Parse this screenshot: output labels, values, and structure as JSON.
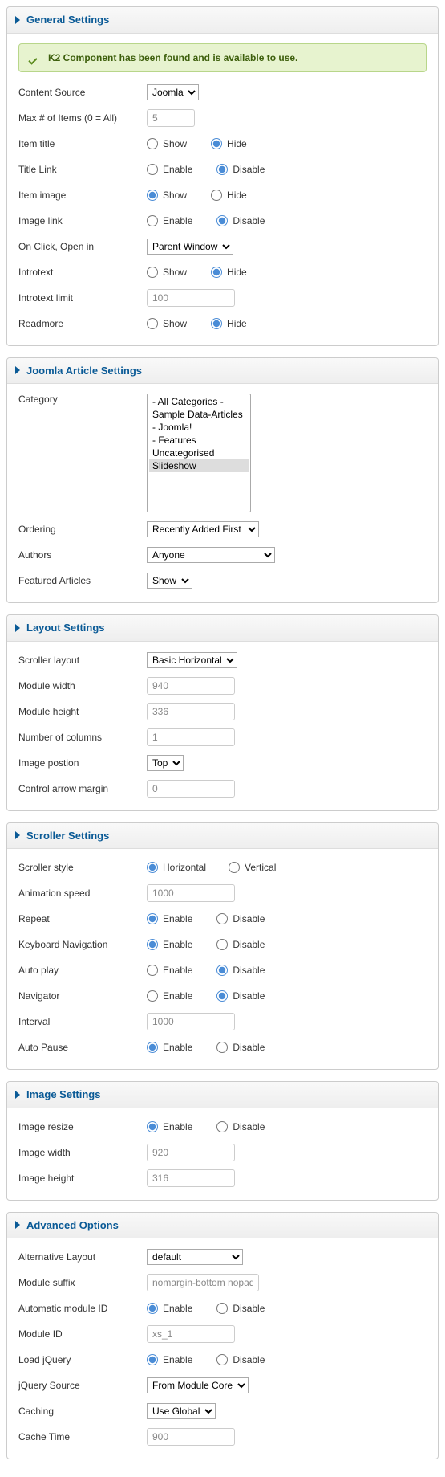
{
  "general": {
    "title": "General Settings",
    "info": "K2 Component has been found and is available to use.",
    "content_source": {
      "label": "Content Source",
      "value": "Joomla"
    },
    "max_items": {
      "label": "Max # of Items (0 = All)",
      "value": "5"
    },
    "item_title": {
      "label": "Item title",
      "opt1": "Show",
      "opt2": "Hide"
    },
    "title_link": {
      "label": "Title Link",
      "opt1": "Enable",
      "opt2": "Disable"
    },
    "item_image": {
      "label": "Item image",
      "opt1": "Show",
      "opt2": "Hide"
    },
    "image_link": {
      "label": "Image link",
      "opt1": "Enable",
      "opt2": "Disable"
    },
    "on_click": {
      "label": "On Click, Open in",
      "value": "Parent Window"
    },
    "introtext": {
      "label": "Introtext",
      "opt1": "Show",
      "opt2": "Hide"
    },
    "introtext_limit": {
      "label": "Introtext limit",
      "value": "100"
    },
    "readmore": {
      "label": "Readmore",
      "opt1": "Show",
      "opt2": "Hide"
    }
  },
  "joomla": {
    "title": "Joomla Article Settings",
    "category": {
      "label": "Category",
      "options": [
        "- All Categories -",
        "Sample Data-Articles",
        "- Joomla!",
        "- Features",
        "Uncategorised",
        "Slideshow"
      ]
    },
    "ordering": {
      "label": "Ordering",
      "value": "Recently Added First"
    },
    "authors": {
      "label": "Authors",
      "value": "Anyone"
    },
    "featured": {
      "label": "Featured Articles",
      "value": "Show"
    }
  },
  "layout": {
    "title": "Layout Settings",
    "scroller_layout": {
      "label": "Scroller layout",
      "value": "Basic Horizontal"
    },
    "module_width": {
      "label": "Module width",
      "value": "940"
    },
    "module_height": {
      "label": "Module height",
      "value": "336"
    },
    "num_columns": {
      "label": "Number of columns",
      "value": "1"
    },
    "image_position": {
      "label": "Image postion",
      "value": "Top"
    },
    "control_margin": {
      "label": "Control arrow margin",
      "value": "0"
    }
  },
  "scroller": {
    "title": "Scroller Settings",
    "style": {
      "label": "Scroller style",
      "opt1": "Horizontal",
      "opt2": "Vertical"
    },
    "speed": {
      "label": "Animation speed",
      "value": "1000"
    },
    "repeat": {
      "label": "Repeat",
      "opt1": "Enable",
      "opt2": "Disable"
    },
    "keyboard": {
      "label": "Keyboard Navigation",
      "opt1": "Enable",
      "opt2": "Disable"
    },
    "autoplay": {
      "label": "Auto play",
      "opt1": "Enable",
      "opt2": "Disable"
    },
    "navigator": {
      "label": "Navigator",
      "opt1": "Enable",
      "opt2": "Disable"
    },
    "interval": {
      "label": "Interval",
      "value": "1000"
    },
    "autopause": {
      "label": "Auto Pause",
      "opt1": "Enable",
      "opt2": "Disable"
    }
  },
  "image": {
    "title": "Image Settings",
    "resize": {
      "label": "Image resize",
      "opt1": "Enable",
      "opt2": "Disable"
    },
    "width": {
      "label": "Image width",
      "value": "920"
    },
    "height": {
      "label": "Image height",
      "value": "316"
    }
  },
  "advanced": {
    "title": "Advanced Options",
    "alt_layout": {
      "label": "Alternative Layout",
      "value": "default"
    },
    "suffix": {
      "label": "Module suffix",
      "value": "nomargin-bottom nopaddin"
    },
    "auto_id": {
      "label": "Automatic module ID",
      "opt1": "Enable",
      "opt2": "Disable"
    },
    "module_id": {
      "label": "Module ID",
      "value": "xs_1"
    },
    "jquery": {
      "label": "Load jQuery",
      "opt1": "Enable",
      "opt2": "Disable"
    },
    "jq_source": {
      "label": "jQuery Source",
      "value": "From Module Core"
    },
    "caching": {
      "label": "Caching",
      "value": "Use Global"
    },
    "cache_time": {
      "label": "Cache Time",
      "value": "900"
    }
  }
}
